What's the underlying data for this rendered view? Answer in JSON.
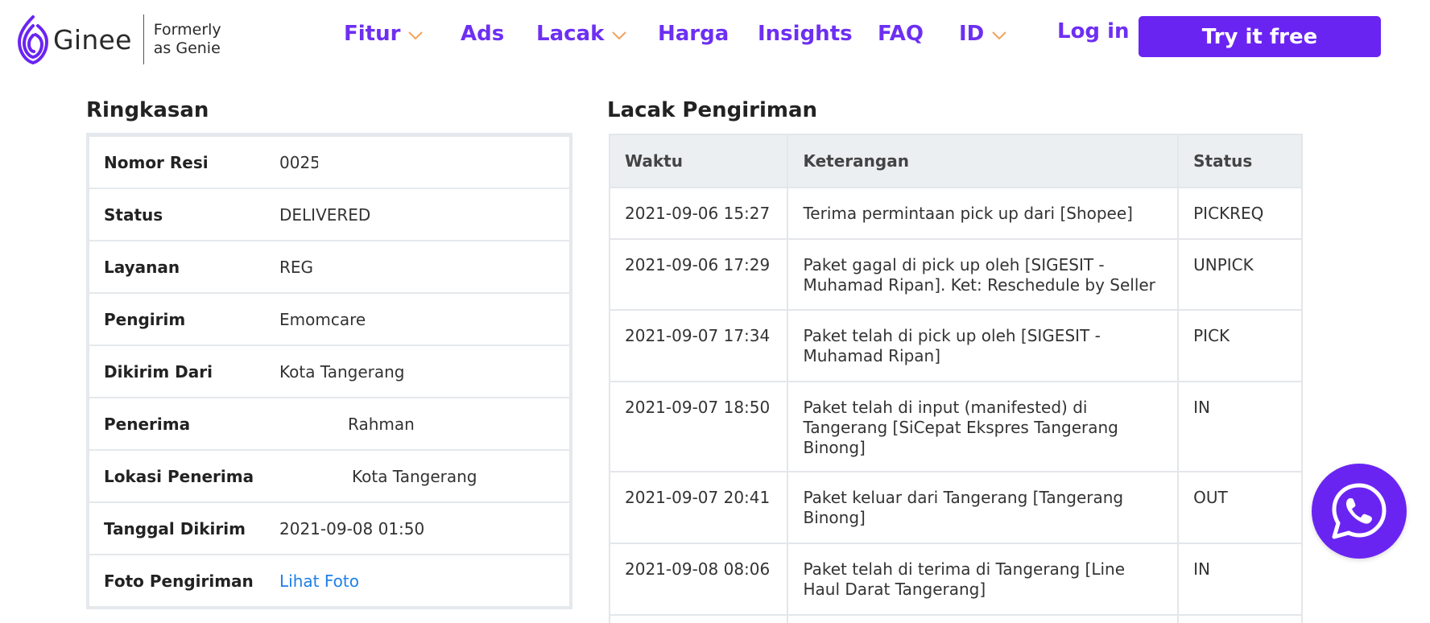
{
  "header": {
    "logo_text": "Ginee",
    "logo_sub_line1": "Formerly",
    "logo_sub_line2": "as Genie",
    "nav": [
      {
        "label": "Fitur",
        "has_dropdown": true
      },
      {
        "label": "Ads",
        "has_dropdown": false
      },
      {
        "label": "Lacak",
        "has_dropdown": true
      },
      {
        "label": "Harga",
        "has_dropdown": false
      },
      {
        "label": "Insights",
        "has_dropdown": false
      },
      {
        "label": "FAQ",
        "has_dropdown": false
      },
      {
        "label": "ID",
        "has_dropdown": true
      }
    ],
    "login_label": "Log in",
    "cta_label": "Try it free"
  },
  "summary": {
    "title": "Ringkasan",
    "rows": [
      {
        "key": "Nomor Resi",
        "value": "0025"
      },
      {
        "key": "Status",
        "value": "DELIVERED"
      },
      {
        "key": "Layanan",
        "value": "REG"
      },
      {
        "key": "Pengirim",
        "value": "Emomcare"
      },
      {
        "key": "Dikirim Dari",
        "value": "Kota Tangerang"
      },
      {
        "key": "Penerima",
        "value": "Rahman"
      },
      {
        "key": "Lokasi Penerima",
        "value": "Kota Tangerang"
      },
      {
        "key": "Tanggal Dikirim",
        "value": "2021-09-08 01:50"
      },
      {
        "key": "Foto Pengiriman",
        "value": "Lihat Foto"
      }
    ]
  },
  "tracking": {
    "title": "Lacak Pengiriman",
    "columns": [
      "Waktu",
      "Keterangan",
      "Status"
    ],
    "rows": [
      {
        "time": "2021-09-06 15:27",
        "desc": "Terima permintaan pick up dari [Shopee]",
        "status": "PICKREQ"
      },
      {
        "time": "2021-09-06 17:29",
        "desc": "Paket gagal di pick up oleh [SIGESIT - Muhamad Ripan]. Ket: Reschedule by Seller",
        "status": "UNPICK"
      },
      {
        "time": "2021-09-07 17:34",
        "desc": "Paket telah di pick up oleh [SIGESIT - Muhamad Ripan]",
        "status": "PICK"
      },
      {
        "time": "2021-09-07 18:50",
        "desc": "Paket telah di input (manifested) di Tangerang [SiCepat Ekspres Tangerang Binong]",
        "status": "IN"
      },
      {
        "time": "2021-09-07 20:41",
        "desc": "Paket keluar dari Tangerang [Tangerang Binong]",
        "status": "OUT"
      },
      {
        "time": "2021-09-08 08:06",
        "desc": "Paket telah di terima di Tangerang [Line Haul Darat Tangerang]",
        "status": "IN"
      }
    ]
  },
  "icons": {
    "logo": "ginee-leaf-logo-icon",
    "dropdown": "chevron-down-icon",
    "whatsapp": "whatsapp-icon"
  },
  "colors": {
    "brand_purple": "#6a24f2",
    "nav_purple": "#6d2ff2",
    "chevron_orange": "#f2a35a",
    "link_blue": "#1e7fe8",
    "table_header_bg": "#eceff2",
    "table_border": "#e3e6ea"
  }
}
